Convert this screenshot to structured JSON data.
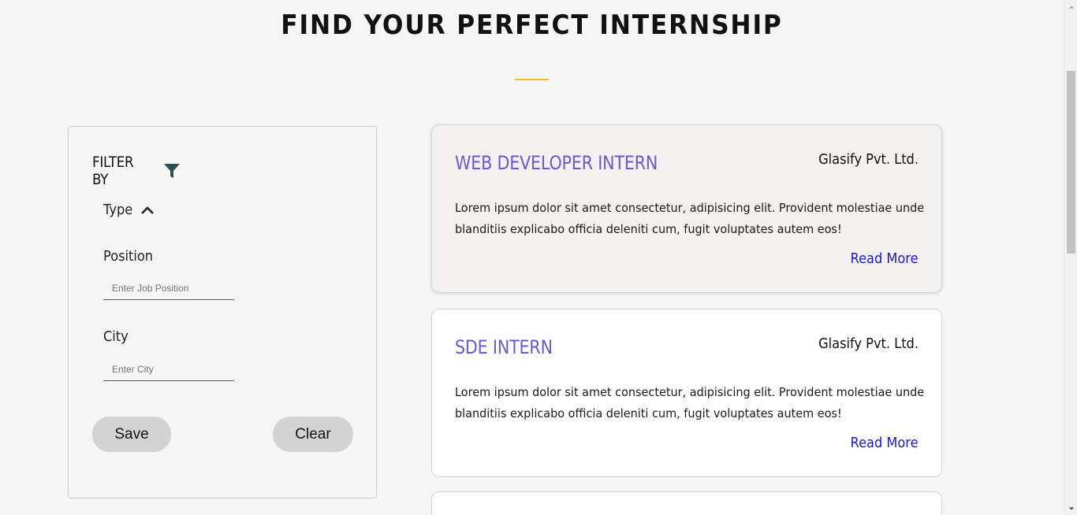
{
  "page": {
    "title": "FIND YOUR PERFECT INTERNSHIP",
    "accent_color": "#f2c014"
  },
  "filter": {
    "title": "FILTER BY",
    "icon": "filter-icon",
    "type_label": "Type",
    "type_toggle_icon": "chevron-up-icon",
    "position_label": "Position",
    "position_placeholder": "Enter Job Position",
    "position_value": "",
    "city_label": "City",
    "city_placeholder": "Enter City",
    "city_value": "",
    "save_label": "Save",
    "clear_label": "Clear"
  },
  "cards": [
    {
      "title": "WEB DEVELOPER INTERN",
      "company": "Glasify Pvt. Ltd.",
      "description": "Lorem ipsum dolor sit amet consectetur, adipisicing elit. Provident molestiae unde blanditiis explicabo officia deleniti cum, fugit voluptates autem eos!",
      "link_label": "Read More"
    },
    {
      "title": "SDE INTERN",
      "company": "Glasify Pvt. Ltd.",
      "description": "Lorem ipsum dolor sit amet consectetur, adipisicing elit. Provident molestiae unde blanditiis explicabo officia deleniti cum, fugit voluptates autem eos!",
      "link_label": "Read More"
    }
  ],
  "colors": {
    "card_title": "#6a5acd",
    "link": "#1a1acc",
    "button_bg": "#d3d3d3"
  }
}
